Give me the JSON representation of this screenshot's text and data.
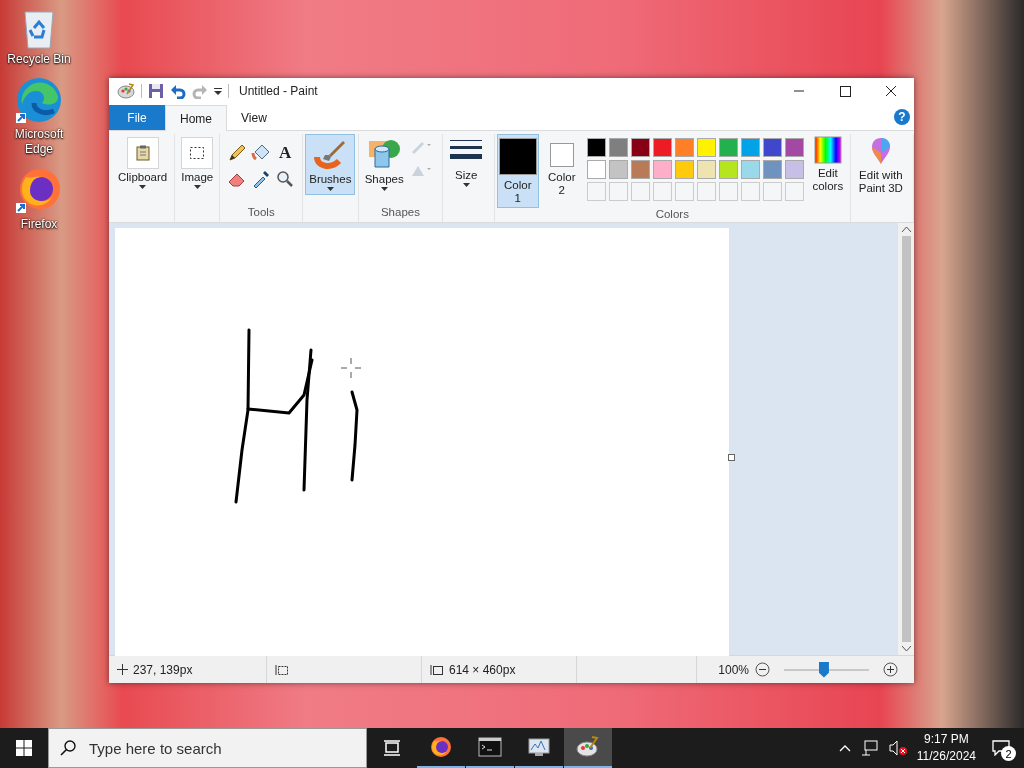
{
  "desktop_icons": [
    {
      "label": "Recycle Bin",
      "kind": "recycle"
    },
    {
      "label": "Microsoft Edge",
      "kind": "edge"
    },
    {
      "label": "Firefox",
      "kind": "firefox"
    }
  ],
  "window": {
    "title": "Untitled - Paint",
    "help": "?"
  },
  "tabs": [
    {
      "label": "File",
      "kind": "menu",
      "selected": false
    },
    {
      "label": "Home",
      "kind": "tab",
      "selected": true
    },
    {
      "label": "View",
      "kind": "tab",
      "selected": false
    }
  ],
  "ribbon": {
    "clipboard": {
      "label": "Clipboard"
    },
    "image": {
      "label": "Image"
    },
    "text_tool": "A",
    "tools_label": "Tools",
    "brushes": {
      "label": "Brushes",
      "selected": true
    },
    "shapes": {
      "label": "Shapes"
    },
    "shapes_label": "Shapes",
    "size": {
      "label": "Size"
    },
    "colors": [
      {
        "label": "Color 1",
        "color": "#000000",
        "selected": true
      },
      {
        "label": "Color 2",
        "color": "#ffffff",
        "selected": false
      }
    ],
    "palette": [
      {
        "color": "#000000"
      },
      {
        "color": "#7f7f7f"
      },
      {
        "color": "#880015"
      },
      {
        "color": "#ed1c24"
      },
      {
        "color": "#ff7f27"
      },
      {
        "color": "#fff200"
      },
      {
        "color": "#22b14c"
      },
      {
        "color": "#00a2e8"
      },
      {
        "color": "#3f48cc"
      },
      {
        "color": "#a349a4"
      },
      {
        "color": "#ffffff"
      },
      {
        "color": "#c3c3c3"
      },
      {
        "color": "#b97a57"
      },
      {
        "color": "#ffaec9"
      },
      {
        "color": "#ffc90e"
      },
      {
        "color": "#efe4b0"
      },
      {
        "color": "#b5e61d"
      },
      {
        "color": "#99d9ea"
      },
      {
        "color": "#7092be"
      },
      {
        "color": "#c8bfe7"
      }
    ],
    "edit_colors": "Edit colors",
    "colors_label": "Colors",
    "paint3d": "Edit with Paint 3D"
  },
  "status": {
    "position": "237, 139px",
    "size": "614 × 460px",
    "zoom": "100%",
    "zoom_slider": {
      "level": 0.47
    }
  },
  "taskbar": {
    "search": {
      "placeholder": "Type here to search"
    },
    "apps": [
      {
        "kind": "firefox",
        "selected": false
      },
      {
        "kind": "terminal",
        "selected": false
      },
      {
        "kind": "monitor",
        "selected": false
      },
      {
        "kind": "paint",
        "selected": true
      }
    ],
    "time": "9:17 PM",
    "date": "11/26/2024",
    "notifications": "2"
  }
}
